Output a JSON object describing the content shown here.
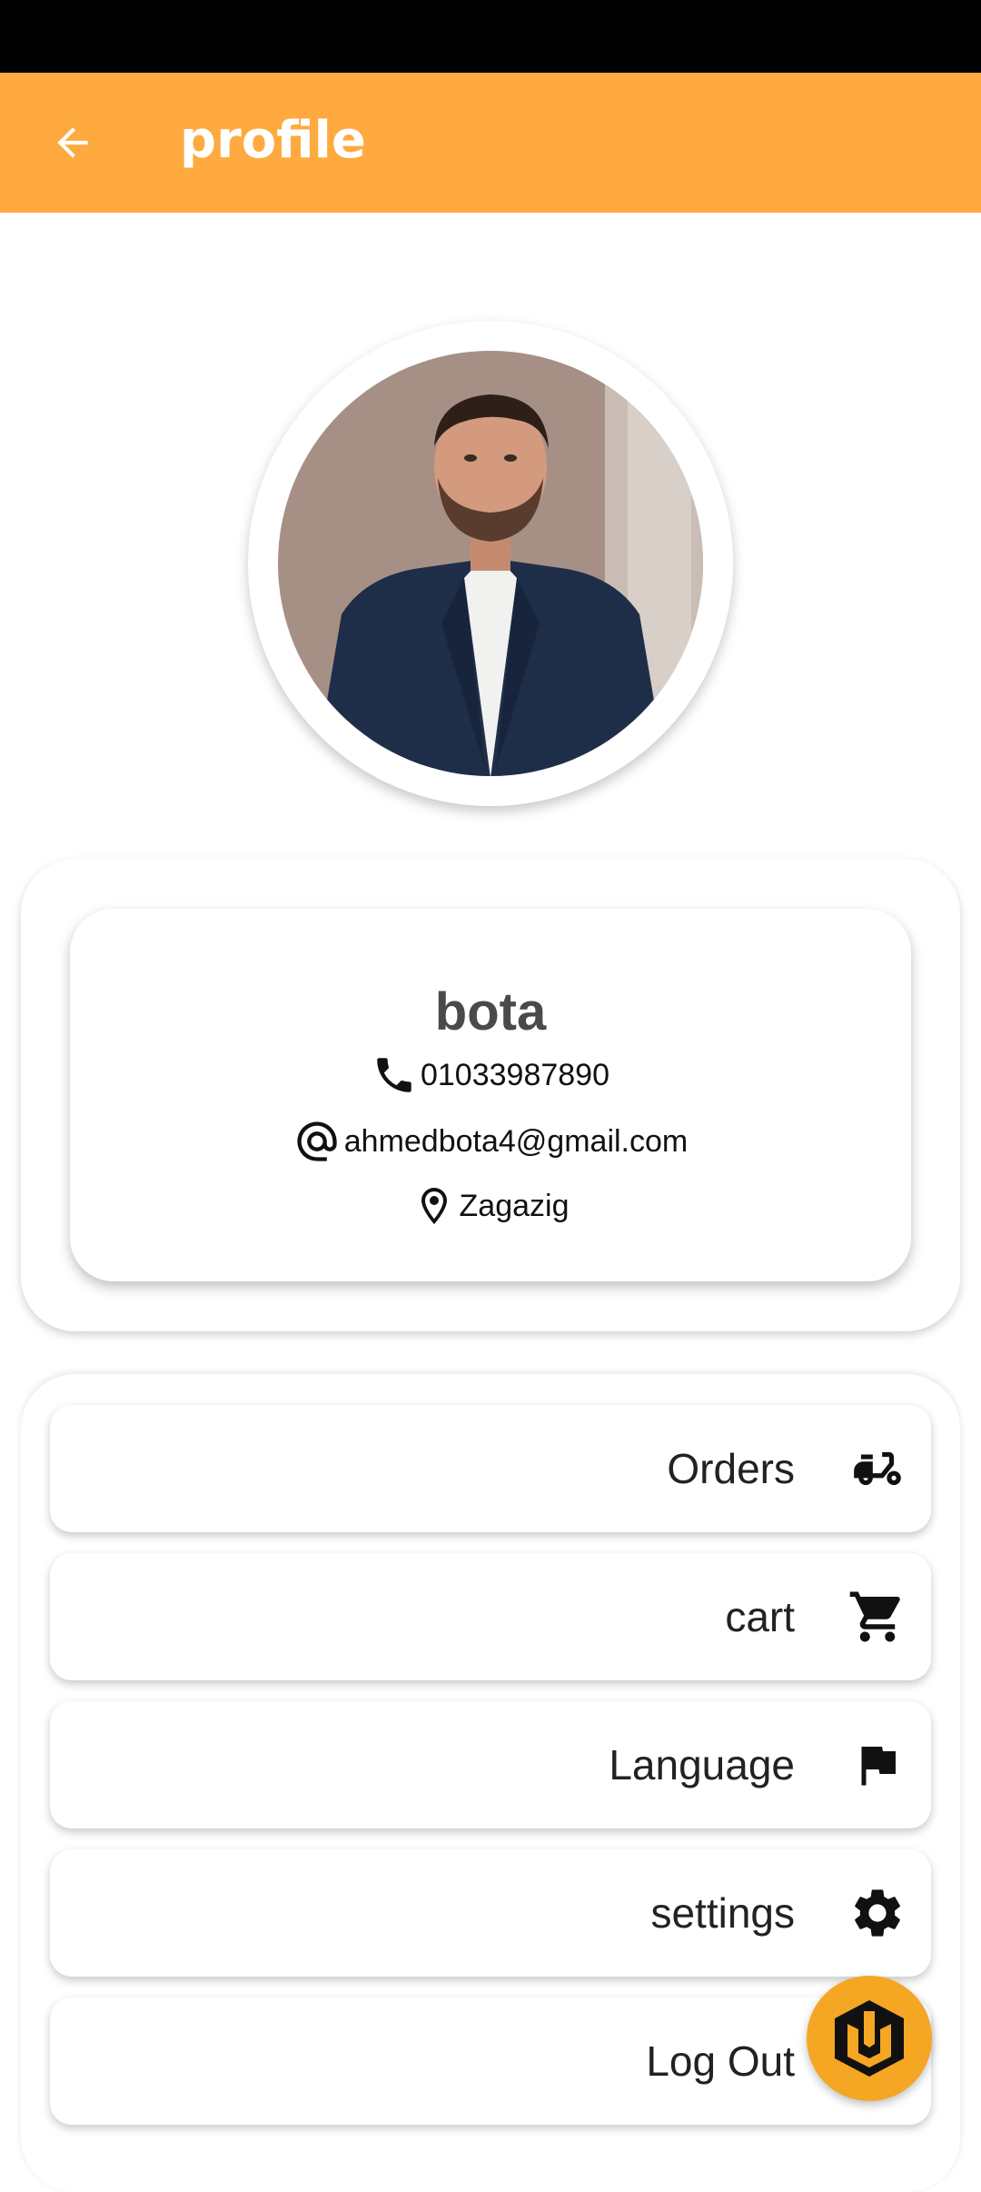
{
  "app_bar": {
    "title": "profile",
    "back_icon": "arrow-back-icon"
  },
  "colors": {
    "accent": "#FEAA3F",
    "fab": "#F5A623"
  },
  "profile": {
    "name": "bota",
    "phone": "01033987890",
    "email": "ahmedbota4@gmail.com",
    "location": "Zagazig",
    "phone_icon": "phone-icon",
    "email_icon": "at-icon",
    "location_icon": "location-pin-icon"
  },
  "menu": {
    "items": [
      {
        "label": "Orders",
        "icon": "delivery-scooter-icon"
      },
      {
        "label": "cart",
        "icon": "shopping-cart-icon"
      },
      {
        "label": "Language",
        "icon": "flag-icon"
      },
      {
        "label": "settings",
        "icon": "gear-icon"
      },
      {
        "label": "Log Out",
        "icon": "logout-icon"
      }
    ]
  },
  "fab": {
    "icon": "app-logo-icon"
  }
}
